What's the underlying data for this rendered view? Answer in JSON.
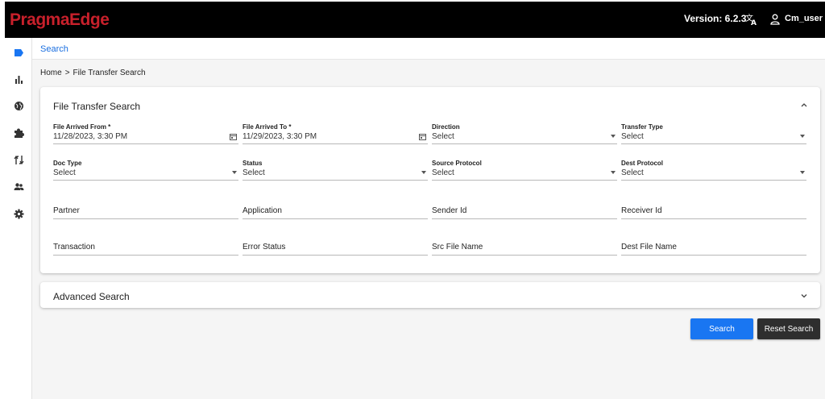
{
  "app": {
    "logo_text": "PragmaEdge",
    "version": "Version: 6.2.3",
    "username": "Cm_user",
    "brand_color": "#c8202b",
    "accent_color": "#1976f2"
  },
  "sidebar": {
    "items": [
      {
        "icon": "search-tag-icon",
        "active": true
      },
      {
        "icon": "bar-chart-icon"
      },
      {
        "icon": "globe-icon"
      },
      {
        "icon": "puzzle-icon"
      },
      {
        "icon": "route-icon"
      },
      {
        "icon": "users-icon"
      },
      {
        "icon": "gear-icon"
      }
    ]
  },
  "subheader": {
    "title": "Search"
  },
  "breadcrumb": {
    "home": "Home",
    "separator": ">",
    "current": "File Transfer Search"
  },
  "form": {
    "title": "File Transfer Search",
    "fields": {
      "arrived_from": {
        "label": "File Arrived From *",
        "value": "11/28/2023, 3:30 PM"
      },
      "arrived_to": {
        "label": "File Arrived To *",
        "value": "11/29/2023, 3:30 PM"
      },
      "direction": {
        "label": "Direction",
        "value": "Select"
      },
      "transfer_type": {
        "label": "Transfer Type",
        "value": "Select"
      },
      "doc_type": {
        "label": "Doc Type",
        "value": "Select"
      },
      "status": {
        "label": "Status",
        "value": "Select"
      },
      "source_protocol": {
        "label": "Source Protocol",
        "value": "Select"
      },
      "dest_protocol": {
        "label": "Dest Protocol",
        "value": "Select"
      },
      "partner": {
        "label": "Partner"
      },
      "application": {
        "label": "Application"
      },
      "sender_id": {
        "label": "Sender Id"
      },
      "receiver_id": {
        "label": "Receiver Id"
      },
      "transaction": {
        "label": "Transaction"
      },
      "error_status": {
        "label": "Error Status"
      },
      "src_file_name": {
        "label": "Src File Name"
      },
      "dest_file_name": {
        "label": "Dest File Name"
      }
    }
  },
  "advanced": {
    "title": "Advanced Search"
  },
  "actions": {
    "search": "Search",
    "reset": "Reset Search"
  }
}
